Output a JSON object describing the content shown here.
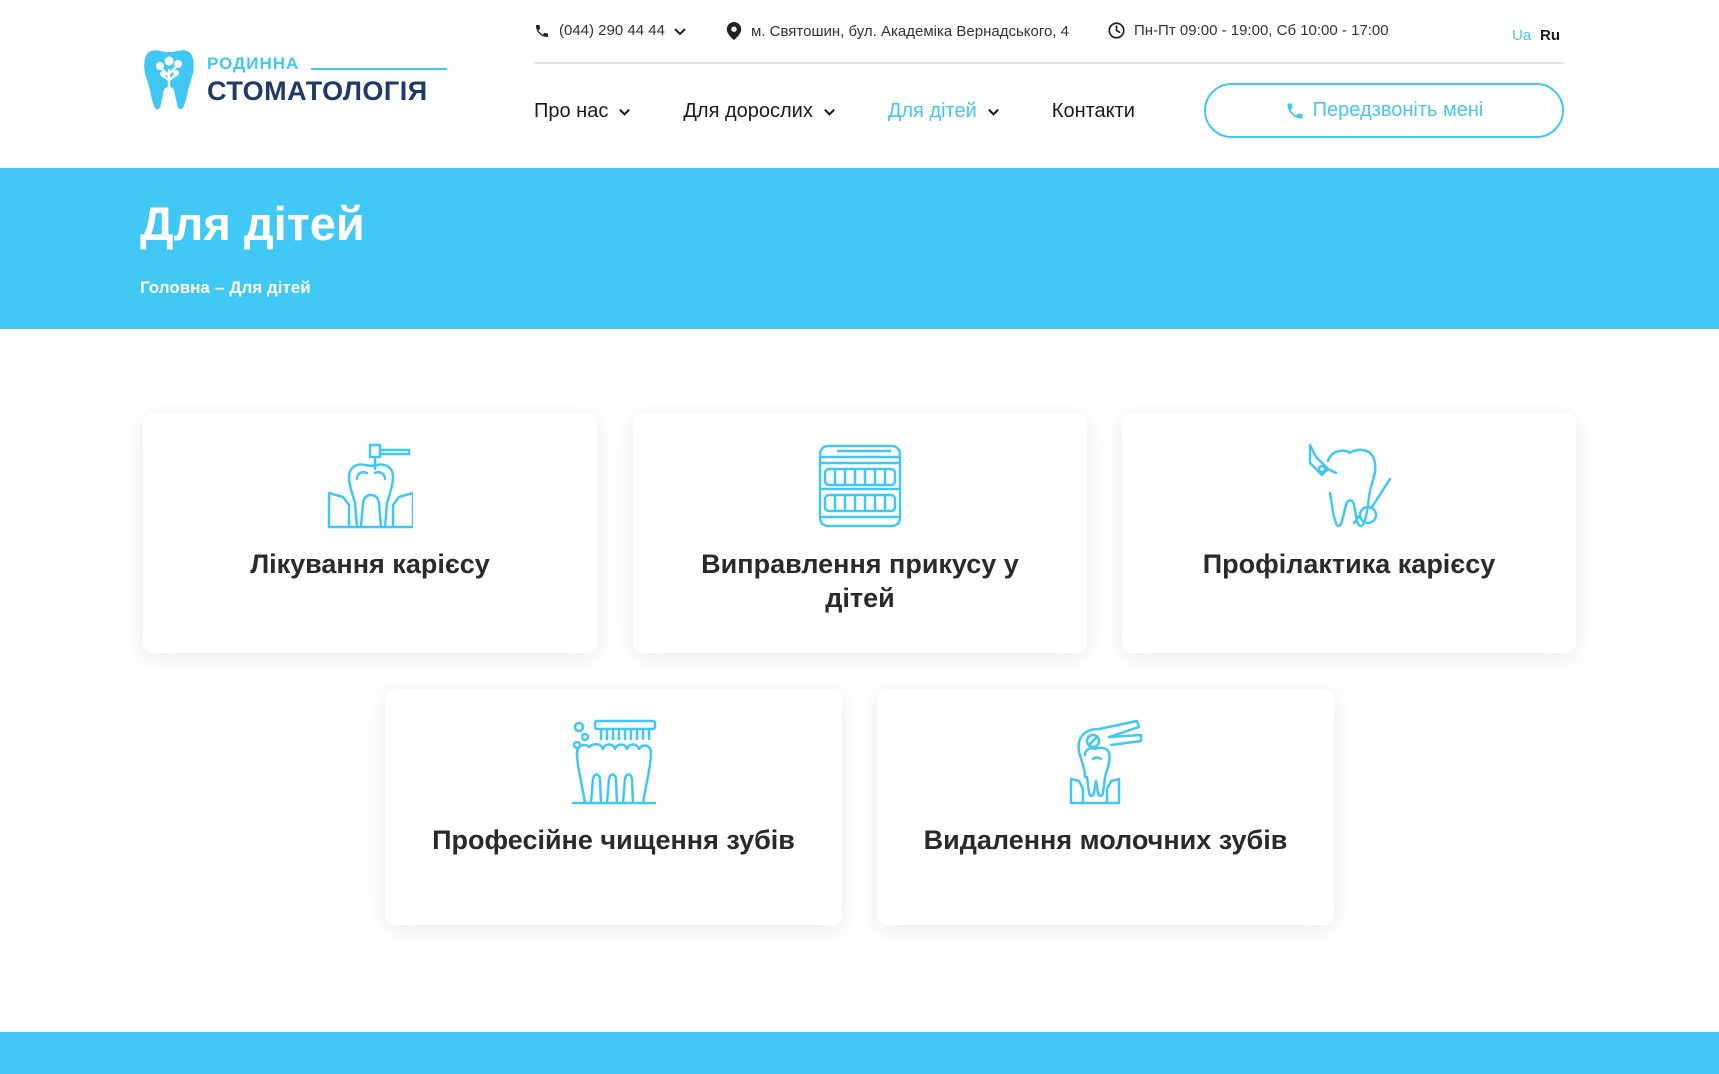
{
  "logo": {
    "small": "РОДИННА",
    "big": "СТОМАТОЛОГІЯ"
  },
  "topbar": {
    "phone": "(044) 290 44 44",
    "address": "м. Святошин, бул. Академіка Вернадського, 4",
    "hours": "Пн-Пт 09:00 - 19:00, Сб 10:00 - 17:00",
    "lang_ua": "Ua",
    "lang_ru": "Ru"
  },
  "nav": {
    "items": [
      {
        "label": "Про нас"
      },
      {
        "label": "Для дорослих"
      },
      {
        "label": "Для дітей"
      },
      {
        "label": "Контакти"
      }
    ],
    "call_button": "Передзвоніть мені"
  },
  "banner": {
    "title": "Для дітей",
    "breadcrumb": {
      "home": "Головна",
      "sep": "–",
      "current": "Для дітей"
    }
  },
  "cards": [
    {
      "title": "Лікування карієсу",
      "icon": "tooth-drill-icon"
    },
    {
      "title": "Виправлення прикусу у дітей",
      "icon": "braces-jaw-icon"
    },
    {
      "title": "Профілактика карієсу",
      "icon": "tooth-mirror-icon"
    },
    {
      "title": "Професійне чищення зубів",
      "icon": "toothbrush-teeth-icon"
    },
    {
      "title": "Видалення молочних зубів",
      "icon": "tooth-extraction-icon"
    }
  ],
  "colors": {
    "accent": "#42c8f4",
    "brand_dark": "#1f3a68",
    "text": "#222222"
  }
}
